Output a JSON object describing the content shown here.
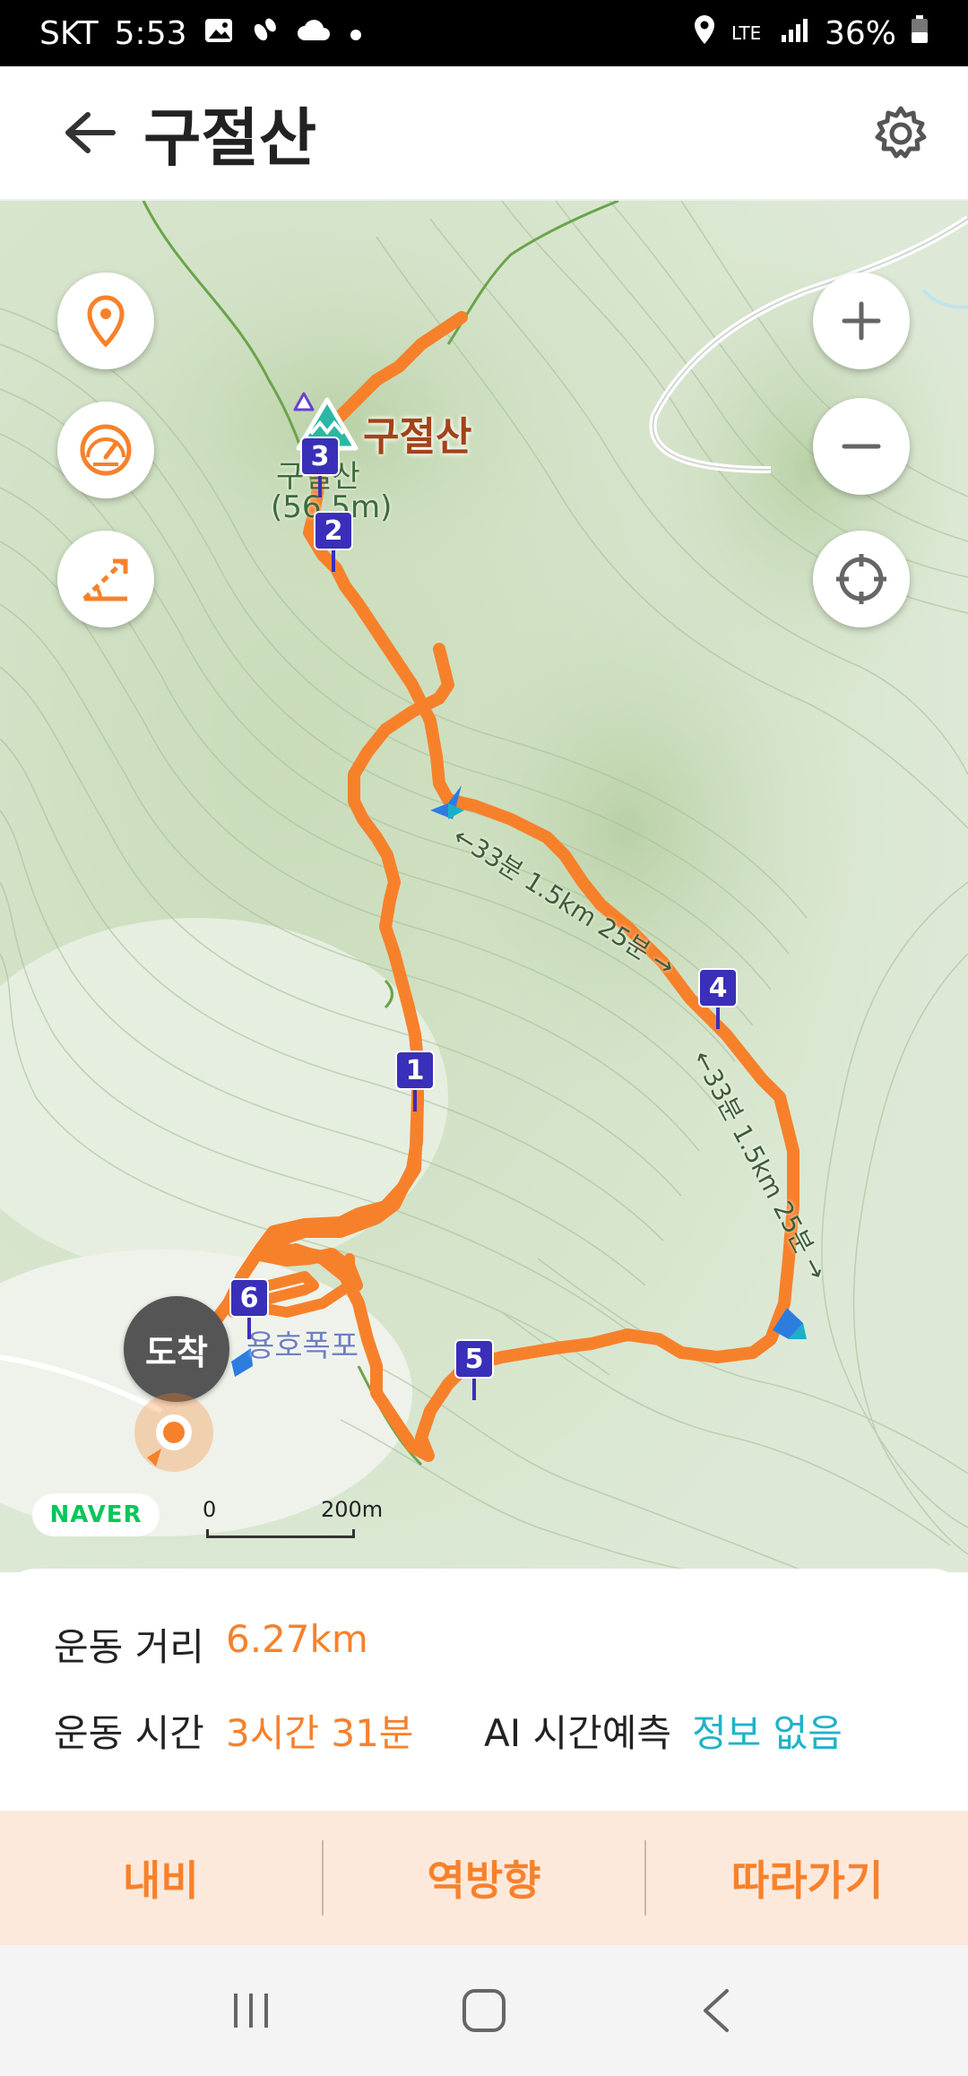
{
  "status_bar": {
    "carrier": "SKT",
    "time": "5:53",
    "network": "LTE",
    "battery": "36%"
  },
  "app_bar": {
    "title": "구절산",
    "back_icon": "arrow-left-icon",
    "settings_icon": "gear-icon"
  },
  "map": {
    "peak_name": "구절산",
    "peak_label_line1": "구절산",
    "peak_label_line2": "(56 5m)",
    "waterfall_label": "용호폭포",
    "trail_label_1": "←33분 1.5km 25분 →",
    "trail_label_2": "←33분 1.5km 25분 →",
    "arrival_label": "도착",
    "markers": [
      "1",
      "2",
      "3",
      "4",
      "5",
      "6"
    ],
    "brand": "NAVER",
    "scale_zero": "0",
    "scale_distance": "200m",
    "left_tools": [
      "location-pin-icon",
      "speedometer-icon",
      "slope-icon"
    ],
    "right_tools": [
      "zoom-in-icon",
      "zoom-out-icon",
      "crosshair-icon"
    ]
  },
  "info": {
    "distance_label": "운동 거리",
    "distance_value": "6.27km",
    "time_label": "운동 시간",
    "time_value": "3시간 31분",
    "ai_label": "AI 시간예측",
    "ai_value": "정보 없음"
  },
  "actions": {
    "navigate": "내비",
    "reverse": "역방향",
    "follow": "따라가기"
  },
  "colors": {
    "accent": "#f7812b",
    "ai_value": "#1fb3c9",
    "route": "#f7812b",
    "marker": "#3a2fb8"
  }
}
